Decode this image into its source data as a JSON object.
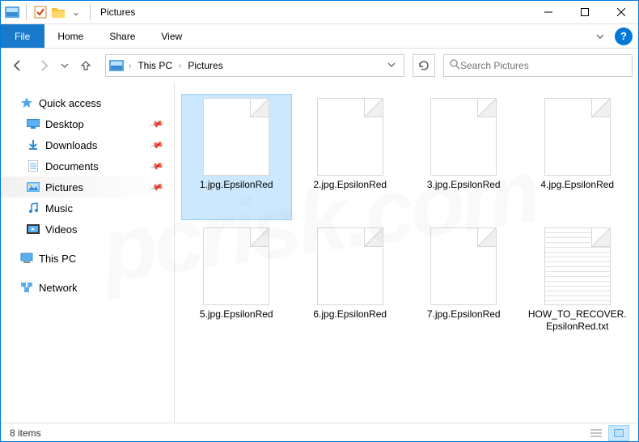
{
  "title": "Pictures",
  "ribbon": {
    "file": "File",
    "home": "Home",
    "share": "Share",
    "view": "View",
    "help": "?"
  },
  "breadcrumb": {
    "items": [
      "This PC",
      "Pictures"
    ]
  },
  "search": {
    "placeholder": "Search Pictures"
  },
  "sidebar": {
    "quick_access": "Quick access",
    "items": [
      {
        "label": "Desktop",
        "pinned": true
      },
      {
        "label": "Downloads",
        "pinned": true
      },
      {
        "label": "Documents",
        "pinned": true
      },
      {
        "label": "Pictures",
        "pinned": true,
        "selected": true
      },
      {
        "label": "Music",
        "pinned": false
      },
      {
        "label": "Videos",
        "pinned": false
      }
    ],
    "this_pc": "This PC",
    "network": "Network"
  },
  "files": [
    {
      "name": "1.jpg.EpsilonRed",
      "type": "blank",
      "selected": true
    },
    {
      "name": "2.jpg.EpsilonRed",
      "type": "blank"
    },
    {
      "name": "3.jpg.EpsilonRed",
      "type": "blank"
    },
    {
      "name": "4.jpg.EpsilonRed",
      "type": "blank"
    },
    {
      "name": "5.jpg.EpsilonRed",
      "type": "blank"
    },
    {
      "name": "6.jpg.EpsilonRed",
      "type": "blank"
    },
    {
      "name": "7.jpg.EpsilonRed",
      "type": "blank"
    },
    {
      "name": "HOW_TO_RECOVER.EpsilonRed.txt",
      "type": "text"
    }
  ],
  "status": {
    "count": "8 items"
  },
  "watermark": "pcrisk.com"
}
